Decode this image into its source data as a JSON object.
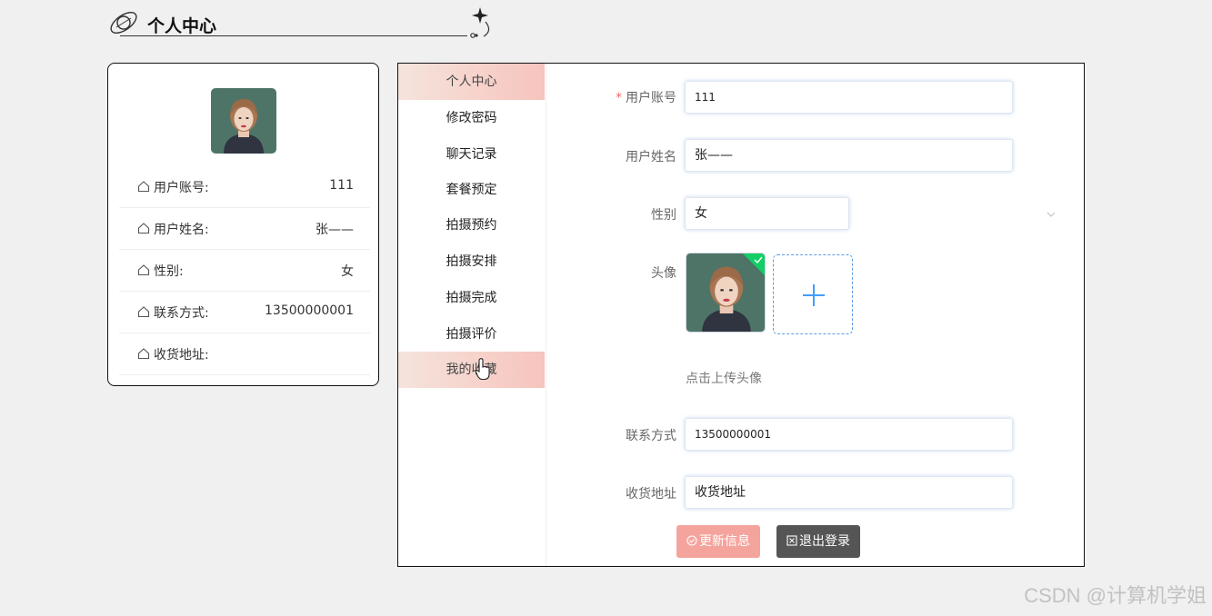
{
  "header": {
    "title": "个人中心"
  },
  "profile": {
    "rows": [
      {
        "label": "用户账号:",
        "value": "111"
      },
      {
        "label": "用户姓名:",
        "value": "张——"
      },
      {
        "label": "性别:",
        "value": "女"
      },
      {
        "label": "联系方式:",
        "value": "13500000001"
      },
      {
        "label": "收货地址:",
        "value": ""
      }
    ]
  },
  "menu": {
    "items": [
      {
        "label": "个人中心",
        "active": true
      },
      {
        "label": "修改密码",
        "active": false
      },
      {
        "label": "聊天记录",
        "active": false
      },
      {
        "label": "套餐预定",
        "active": false
      },
      {
        "label": "拍摄预约",
        "active": false
      },
      {
        "label": "拍摄安排",
        "active": false
      },
      {
        "label": "拍摄完成",
        "active": false
      },
      {
        "label": "拍摄评价",
        "active": false
      },
      {
        "label": "我的收藏",
        "active": true
      }
    ]
  },
  "form": {
    "account": {
      "label": "用户账号",
      "required_mark": "*",
      "value": "111"
    },
    "name": {
      "label": "用户姓名",
      "value": "张——"
    },
    "gender": {
      "label": "性别",
      "value": "女"
    },
    "avatar": {
      "label": "头像",
      "hint": "点击上传头像"
    },
    "phone": {
      "label": "联系方式",
      "value": "13500000001"
    },
    "address": {
      "label": "收货地址",
      "value": "收货地址"
    }
  },
  "buttons": {
    "update": "更新信息",
    "logout": "退出登录"
  },
  "watermark": "CSDN @计算机学姐",
  "colors": {
    "accent": "#f4a49c",
    "menu_active_start": "#f5e4dc",
    "menu_active_end": "#f6c4bd",
    "logout_button": "#555555",
    "upload_border": "#5b9be6",
    "required_mark": "#f56c6c",
    "success_badge": "#13ce66"
  }
}
